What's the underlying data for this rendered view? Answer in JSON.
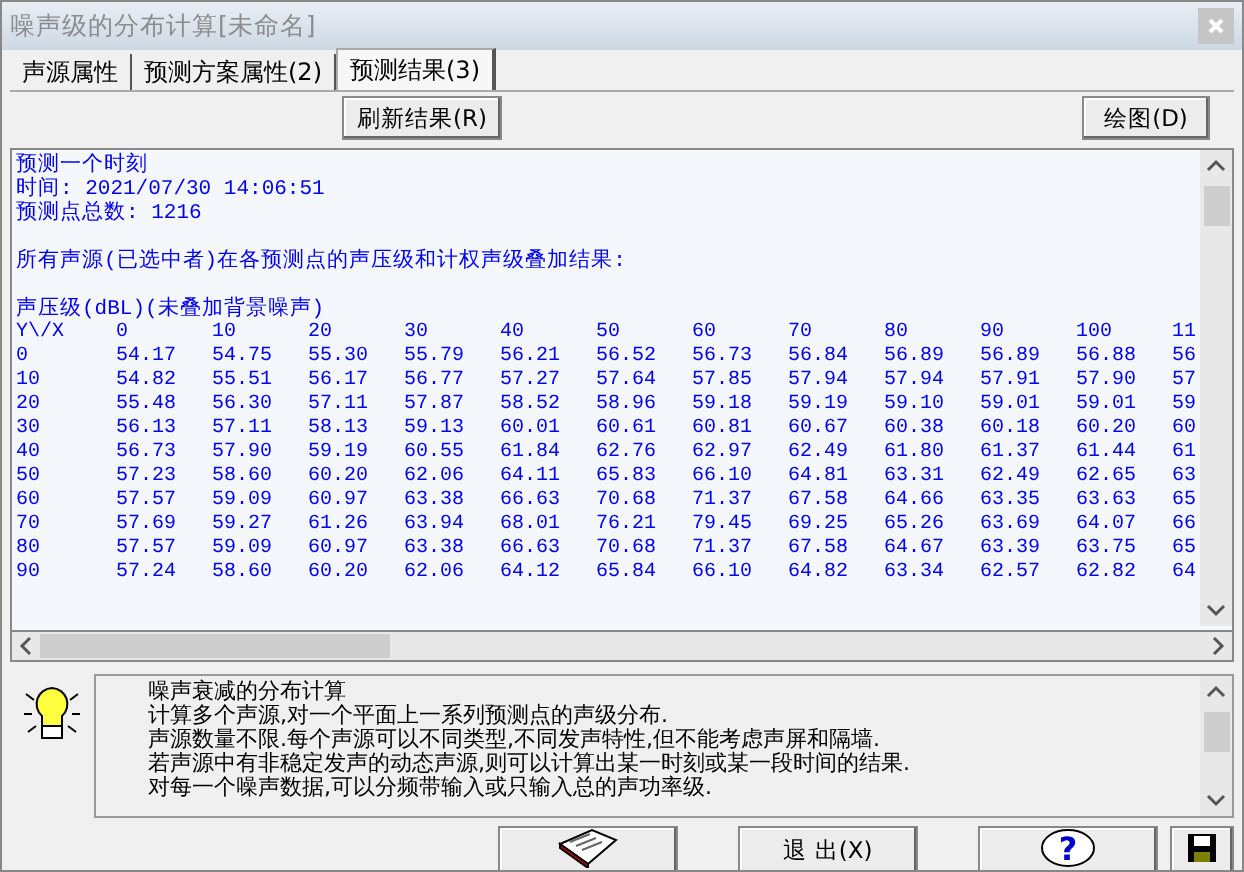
{
  "window": {
    "title": "噪声级的分布计算[未命名]"
  },
  "tabs": [
    {
      "label": "声源属性",
      "selected": false
    },
    {
      "label": "预测方案属性(2)",
      "selected": false
    },
    {
      "label": "预测结果(3)",
      "selected": true
    }
  ],
  "toolbar": {
    "refresh_button": "刷新结果(R)",
    "plot_button": "绘图(D)"
  },
  "output": {
    "header_lines": [
      "预测一个时刻",
      "时间: 2021/07/30 14:06:51",
      "预测点总数: 1216"
    ],
    "summary": "所有声源(已选中者)在各预测点的声压级和计权声级叠加结果:",
    "table_title": "声压级(dBL)(未叠加背景噪声)",
    "columns": [
      "Y\\/X",
      "0",
      "10",
      "20",
      "30",
      "40",
      "50",
      "60",
      "70",
      "80",
      "90",
      "100",
      "11"
    ],
    "rows": [
      [
        "0",
        "54.17",
        "54.75",
        "55.30",
        "55.79",
        "56.21",
        "56.52",
        "56.73",
        "56.84",
        "56.89",
        "56.89",
        "56.88",
        "56"
      ],
      [
        "10",
        "54.82",
        "55.51",
        "56.17",
        "56.77",
        "57.27",
        "57.64",
        "57.85",
        "57.94",
        "57.94",
        "57.91",
        "57.90",
        "57"
      ],
      [
        "20",
        "55.48",
        "56.30",
        "57.11",
        "57.87",
        "58.52",
        "58.96",
        "59.18",
        "59.19",
        "59.10",
        "59.01",
        "59.01",
        "59"
      ],
      [
        "30",
        "56.13",
        "57.11",
        "58.13",
        "59.13",
        "60.01",
        "60.61",
        "60.81",
        "60.67",
        "60.38",
        "60.18",
        "60.20",
        "60"
      ],
      [
        "40",
        "56.73",
        "57.90",
        "59.19",
        "60.55",
        "61.84",
        "62.76",
        "62.97",
        "62.49",
        "61.80",
        "61.37",
        "61.44",
        "61"
      ],
      [
        "50",
        "57.23",
        "58.60",
        "60.20",
        "62.06",
        "64.11",
        "65.83",
        "66.10",
        "64.81",
        "63.31",
        "62.49",
        "62.65",
        "63"
      ],
      [
        "60",
        "57.57",
        "59.09",
        "60.97",
        "63.38",
        "66.63",
        "70.68",
        "71.37",
        "67.58",
        "64.66",
        "63.35",
        "63.63",
        "65"
      ],
      [
        "70",
        "57.69",
        "59.27",
        "61.26",
        "63.94",
        "68.01",
        "76.21",
        "79.45",
        "69.25",
        "65.26",
        "63.69",
        "64.07",
        "66"
      ],
      [
        "80",
        "57.57",
        "59.09",
        "60.97",
        "63.38",
        "66.63",
        "70.68",
        "71.37",
        "67.58",
        "64.67",
        "63.39",
        "63.75",
        "65"
      ],
      [
        "90",
        "57.24",
        "58.60",
        "60.20",
        "62.06",
        "64.12",
        "65.84",
        "66.10",
        "64.82",
        "63.34",
        "62.57",
        "62.82",
        "64"
      ]
    ]
  },
  "help": {
    "lines": [
      "噪声衰减的分布计算",
      "计算多个声源,对一个平面上一系列预测点的声级分布.",
      "声源数量不限.每个声源可以不同类型,不同发声特性,但不能考虑声屏和隔墙.",
      "若声源中有非稳定发声的动态声源,则可以计算出某一时刻或某一段时间的结果.",
      "对每一个噪声数据,可以分频带输入或只输入总的声功率级."
    ]
  },
  "bottom_buttons": {
    "exit_button": "退 出(X)",
    "help_mark": "?"
  }
}
